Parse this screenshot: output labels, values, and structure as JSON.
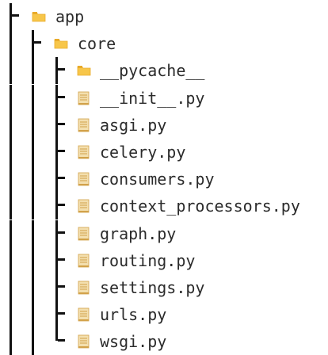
{
  "tree": [
    {
      "label": "app",
      "type": "folder",
      "depth": 0,
      "last": false
    },
    {
      "label": "core",
      "type": "folder",
      "depth": 1,
      "last": false
    },
    {
      "label": "__pycache__",
      "type": "folder",
      "depth": 2,
      "last": false
    },
    {
      "label": "__init__.py",
      "type": "file",
      "depth": 2,
      "last": false
    },
    {
      "label": "asgi.py",
      "type": "file",
      "depth": 2,
      "last": false
    },
    {
      "label": "celery.py",
      "type": "file",
      "depth": 2,
      "last": false
    },
    {
      "label": "consumers.py",
      "type": "file",
      "depth": 2,
      "last": false
    },
    {
      "label": "context_processors.py",
      "type": "file",
      "depth": 2,
      "last": false
    },
    {
      "label": "graph.py",
      "type": "file",
      "depth": 2,
      "last": false
    },
    {
      "label": "routing.py",
      "type": "file",
      "depth": 2,
      "last": false
    },
    {
      "label": "settings.py",
      "type": "file",
      "depth": 2,
      "last": false
    },
    {
      "label": "urls.py",
      "type": "file",
      "depth": 2,
      "last": false
    },
    {
      "label": "wsgi.py",
      "type": "file",
      "depth": 2,
      "last": true
    }
  ],
  "icons": {
    "folder": "folder-icon",
    "file": "python-file-icon"
  },
  "colors": {
    "folder": "#f7c64a",
    "folder_tab": "#e9ab2a",
    "file_paper": "#f3dfae",
    "file_lines": "#d2a24a",
    "text": "#2b2b2b",
    "guides": "#111111"
  }
}
